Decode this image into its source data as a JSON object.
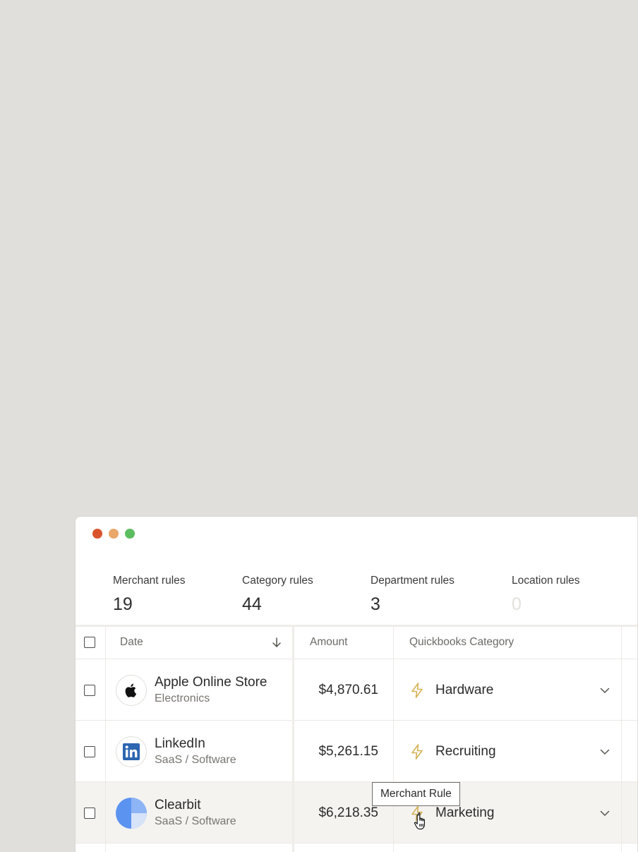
{
  "stats": [
    {
      "label": "Merchant rules",
      "value": "19"
    },
    {
      "label": "Category rules",
      "value": "44"
    },
    {
      "label": "Department rules",
      "value": "3"
    },
    {
      "label": "Location rules",
      "value": "0"
    }
  ],
  "table": {
    "columns": {
      "date": "Date",
      "amount": "Amount",
      "category": "Quickbooks Category"
    },
    "rows": [
      {
        "merchant": "Apple Online Store",
        "subcategory": "Electronics",
        "amount": "$4,870.61",
        "category": "Hardware"
      },
      {
        "merchant": "LinkedIn",
        "subcategory": "SaaS / Software",
        "amount": "$5,261.15",
        "category": "Recruiting"
      },
      {
        "merchant": "Clearbit",
        "subcategory": "SaaS / Software",
        "amount": "$6,218.35",
        "category": "Marketing"
      }
    ]
  },
  "tooltip": {
    "text": "Merchant Rule"
  },
  "colors": {
    "background": "#e0dfdb",
    "bolt": "#d4b258",
    "linkedin": "#2d66b1",
    "clearbit": "#5b93f0",
    "traffic_red": "#d9542c",
    "traffic_yellow": "#e9a76a",
    "traffic_green": "#5cbd60"
  },
  "icons": {
    "sort": "arrow-down-icon",
    "rule": "lightning-bolt-icon",
    "dropdown": "chevron-down-icon",
    "cursor": "hand-pointer-icon"
  }
}
